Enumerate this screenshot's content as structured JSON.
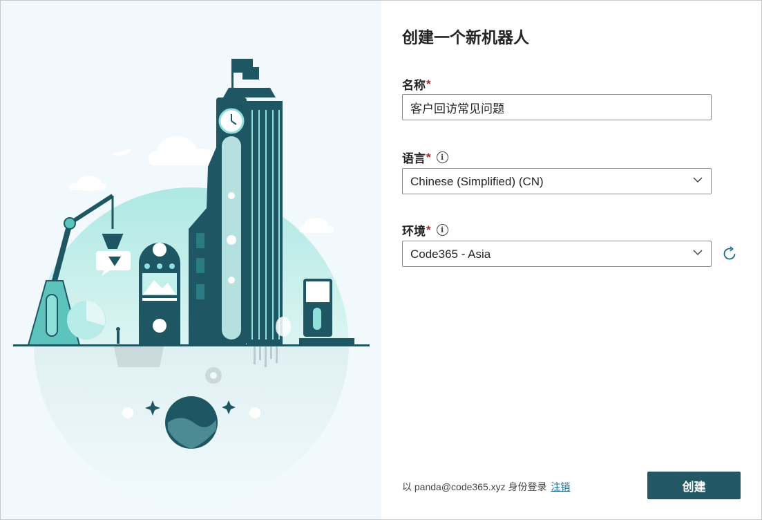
{
  "dialog": {
    "title": "创建一个新机器人"
  },
  "form": {
    "name_label": "名称",
    "name_value": "客户回访常见问题",
    "language_label": "语言",
    "language_value": "Chinese (Simplified) (CN)",
    "environment_label": "环境",
    "environment_value": "Code365 - Asia",
    "required_mark": "*",
    "info_glyph": "i"
  },
  "footer": {
    "signin_prefix": "以 panda@code365.xyz 身份登录",
    "signout_label": "注销",
    "create_label": "创建"
  },
  "icons": {
    "info": "info-circle-icon",
    "chevron": "chevron-down-icon",
    "refresh": "refresh-icon"
  },
  "colors": {
    "primary_button": "#225865",
    "link": "#1a6b8e",
    "required": "#a4262c",
    "illustration_bg": "#f1f9fc",
    "illustration_accent": "#7fd6d0"
  }
}
